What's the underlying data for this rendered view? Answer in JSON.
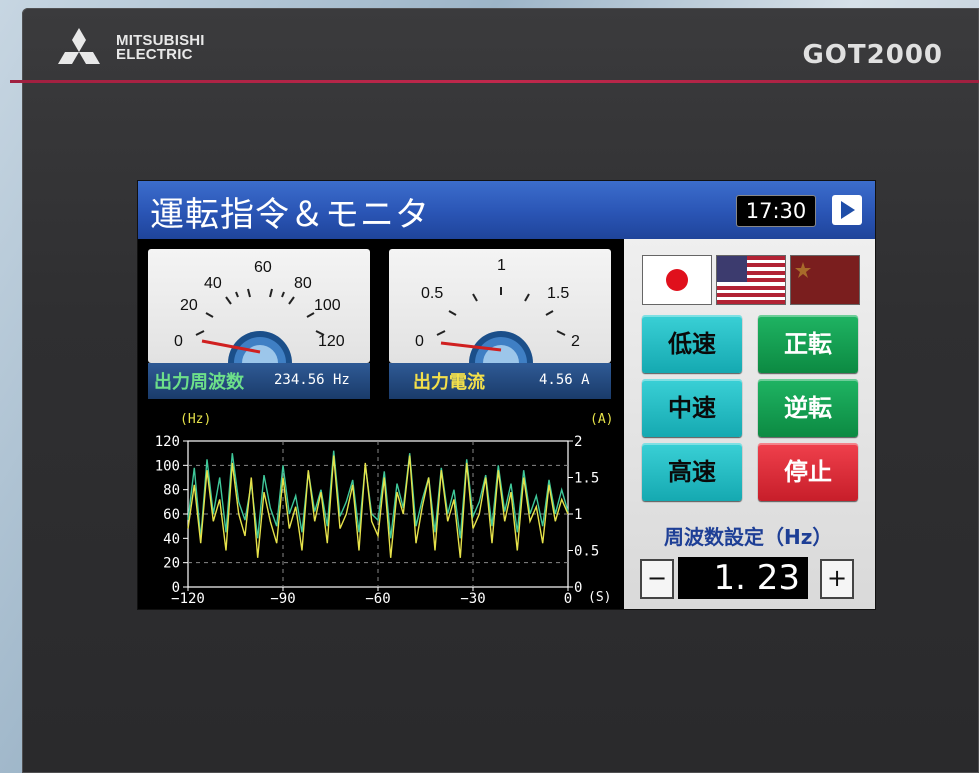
{
  "device": {
    "brand_line1": "MITSUBISHI",
    "brand_line2": "ELECTRIC",
    "model": "GOT2000"
  },
  "screen": {
    "title": "運転指令＆モニタ",
    "clock": "17:30",
    "gauges": [
      {
        "label": "出力周波数",
        "value": "234.56 Hz",
        "ticks": [
          "0",
          "20",
          "40",
          "60",
          "80",
          "100",
          "120"
        ]
      },
      {
        "label": "出力電流",
        "value": "4.56 A",
        "ticks": [
          "0",
          "0.5",
          "1",
          "1.5",
          "2"
        ]
      }
    ],
    "flags": [
      "japan-flag",
      "usa-flag",
      "china-flag"
    ],
    "buttons": {
      "low": "低速",
      "forward": "正転",
      "mid": "中速",
      "reverse": "逆転",
      "high": "高速",
      "stop": "停止"
    },
    "freq_setting_label": "周波数設定（Hz）",
    "freq_setting_value": "1. 23",
    "minus": "−",
    "plus": "+"
  },
  "chart_data": {
    "type": "line",
    "xlabel": "(S)",
    "ylabel_left": "(Hz)",
    "ylabel_right": "(A)",
    "x_ticks": [
      "−120",
      "−90",
      "−60",
      "−30",
      "0"
    ],
    "y_ticks_left": [
      "0",
      "20",
      "40",
      "60",
      "80",
      "100",
      "120"
    ],
    "y_ticks_right": [
      "0",
      "0.5",
      "1",
      "1.5",
      "2"
    ],
    "xlim": [
      -120,
      0
    ],
    "ylim_left": [
      0,
      120
    ],
    "ylim_right": [
      0,
      2
    ],
    "x": [
      -120,
      -118,
      -116,
      -114,
      -112,
      -110,
      -108,
      -106,
      -104,
      -102,
      -100,
      -98,
      -96,
      -94,
      -92,
      -90,
      -88,
      -86,
      -84,
      -82,
      -80,
      -78,
      -76,
      -74,
      -72,
      -70,
      -68,
      -66,
      -64,
      -62,
      -60,
      -58,
      -56,
      -54,
      -52,
      -50,
      -48,
      -46,
      -44,
      -42,
      -40,
      -38,
      -36,
      -34,
      -32,
      -30,
      -28,
      -26,
      -24,
      -22,
      -20,
      -18,
      -16,
      -14,
      -12,
      -10,
      -8,
      -6,
      -4,
      -2,
      0
    ],
    "series": [
      {
        "color": "#3fc89a",
        "values": [
          55,
          98,
          40,
          105,
          60,
          90,
          45,
          110,
          70,
          55,
          85,
          40,
          92,
          65,
          50,
          100,
          60,
          75,
          45,
          95,
          62,
          80,
          50,
          112,
          58,
          70,
          88,
          45,
          100,
          60,
          55,
          95,
          40,
          85,
          65,
          110,
          50,
          72,
          90,
          45,
          98,
          60,
          80,
          40,
          105,
          58,
          70,
          92,
          50,
          100,
          62,
          85,
          45,
          96,
          60,
          75,
          50,
          88,
          60,
          80,
          62
        ]
      },
      {
        "color": "#e6e24a",
        "values": [
          0.8,
          1.4,
          0.6,
          1.6,
          0.9,
          1.2,
          0.5,
          1.7,
          1.0,
          0.7,
          1.5,
          0.4,
          1.3,
          0.9,
          0.6,
          1.5,
          0.8,
          1.1,
          0.5,
          1.6,
          0.9,
          1.3,
          0.6,
          1.8,
          0.8,
          1.0,
          1.4,
          0.5,
          1.7,
          0.9,
          0.7,
          1.5,
          0.4,
          1.3,
          1.0,
          1.8,
          0.6,
          1.1,
          1.5,
          0.5,
          1.6,
          0.9,
          1.2,
          0.4,
          1.7,
          0.8,
          1.0,
          1.5,
          0.6,
          1.6,
          0.9,
          1.3,
          0.5,
          1.5,
          0.9,
          1.1,
          0.6,
          1.4,
          0.9,
          1.2,
          1.0
        ]
      }
    ],
    "grid": true
  }
}
